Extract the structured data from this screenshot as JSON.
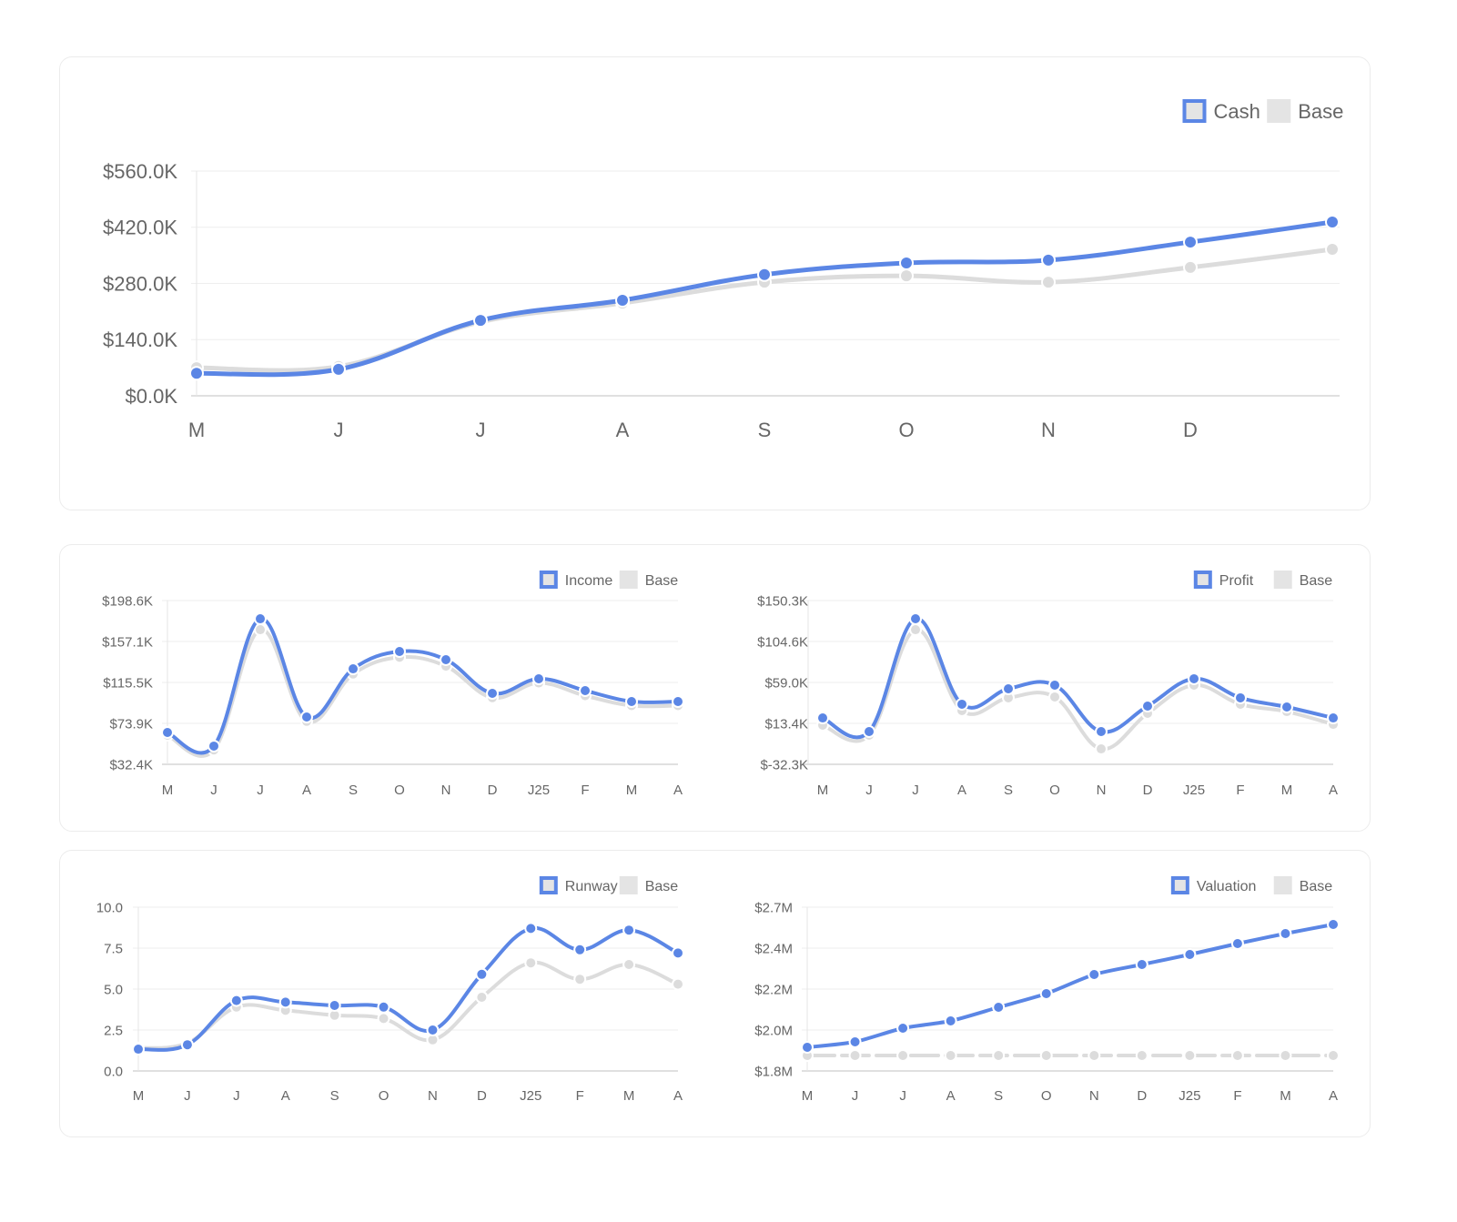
{
  "colors": {
    "primary": "#5b86e5",
    "base": "#dcdcdc",
    "grid": "#eeeeee",
    "axis": "#dddddd",
    "text": "#666666"
  },
  "chart_data": [
    {
      "id": "cash",
      "type": "line",
      "title": "",
      "legend": {
        "placement": "top-right",
        "entries": [
          "Cash",
          "Base"
        ]
      },
      "categories": [
        "M",
        "J",
        "J",
        "A",
        "S",
        "O",
        "N",
        "D",
        ""
      ],
      "yticks": [
        "$0.0K",
        "$140.0K",
        "$280.0K",
        "$420.0K",
        "$560.0K"
      ],
      "ylim": [
        0,
        560000
      ],
      "grid": true,
      "series": [
        {
          "name": "Base",
          "values": [
            70000,
            73000,
            184000,
            231000,
            283000,
            299000,
            283000,
            320000,
            365000
          ]
        },
        {
          "name": "Cash",
          "values": [
            56000,
            66000,
            188000,
            238000,
            302000,
            331000,
            338000,
            383000,
            433000
          ]
        }
      ]
    },
    {
      "id": "income",
      "type": "line",
      "legend": {
        "placement": "top-right",
        "entries": [
          "Income",
          "Base"
        ]
      },
      "categories": [
        "M",
        "J",
        "J",
        "A",
        "S",
        "O",
        "N",
        "D",
        "J25",
        "F",
        "M",
        "A"
      ],
      "yticks": [
        "$32.4K",
        "$73.9K",
        "$115.5K",
        "$157.1K",
        "$198.6K"
      ],
      "ylim": [
        32400,
        198600
      ],
      "grid": true,
      "series": [
        {
          "name": "Base",
          "values": [
            62000,
            47000,
            169000,
            76000,
            124000,
            141000,
            132000,
            100000,
            115000,
            102000,
            92000,
            92000
          ]
        },
        {
          "name": "Income",
          "values": [
            64700,
            50900,
            180100,
            80400,
            129300,
            146900,
            138600,
            104400,
            119200,
            107200,
            96100,
            96100
          ]
        }
      ]
    },
    {
      "id": "profit",
      "type": "line",
      "legend": {
        "placement": "top-right",
        "entries": [
          "Profit",
          "Base"
        ]
      },
      "categories": [
        "M",
        "J",
        "J",
        "A",
        "S",
        "O",
        "N",
        "D",
        "J25",
        "F",
        "M",
        "A"
      ],
      "yticks": [
        "$-32.3K",
        "$13.4K",
        "$59.0K",
        "$104.6K",
        "$150.3K"
      ],
      "ylim": [
        -32300,
        150300
      ],
      "grid": true,
      "series": [
        {
          "name": "Base",
          "values": [
            11300,
            200,
            117800,
            27600,
            41800,
            42800,
            -15100,
            24500,
            56000,
            34700,
            26500,
            12300
          ]
        },
        {
          "name": "Profit",
          "values": [
            19400,
            4200,
            130000,
            34700,
            51900,
            56000,
            4200,
            32600,
            63100,
            41800,
            31600,
            19400
          ]
        }
      ]
    },
    {
      "id": "runway",
      "type": "line",
      "legend": {
        "placement": "top-right",
        "entries": [
          "Runway",
          "Base"
        ]
      },
      "categories": [
        "M",
        "J",
        "J",
        "A",
        "S",
        "O",
        "N",
        "D",
        "J25",
        "F",
        "M",
        "A"
      ],
      "yticks": [
        "0.0",
        "2.5",
        "5.0",
        "7.5",
        "10.0"
      ],
      "ylim": [
        0,
        10
      ],
      "grid": true,
      "series": [
        {
          "name": "Base",
          "values": [
            1.4,
            1.7,
            3.9,
            3.7,
            3.4,
            3.2,
            1.9,
            4.5,
            6.6,
            5.6,
            6.5,
            5.3
          ]
        },
        {
          "name": "Runway",
          "values": [
            1.33,
            1.6,
            4.3,
            4.2,
            4.0,
            3.9,
            2.5,
            5.9,
            8.7,
            7.4,
            8.6,
            7.2
          ]
        }
      ]
    },
    {
      "id": "valuation",
      "type": "line",
      "legend": {
        "placement": "top-right",
        "entries": [
          "Valuation",
          "Base"
        ]
      },
      "categories": [
        "M",
        "J",
        "J",
        "A",
        "S",
        "O",
        "N",
        "D",
        "J25",
        "F",
        "M",
        "A"
      ],
      "yticks": [
        "$1.8M",
        "$2.0M",
        "$2.2M",
        "$2.4M",
        "$2.7M"
      ],
      "ylim": [
        1800000,
        2700000
      ],
      "grid": true,
      "series": [
        {
          "name": "Base",
          "values": [
            1885000,
            1885000,
            1885000,
            1885000,
            1885000,
            1885000,
            1885000,
            1885000,
            1885000,
            1885000,
            1885000,
            1885000
          ]
        },
        {
          "name": "Valuation",
          "values": [
            1930000,
            1960000,
            2035000,
            2075000,
            2150000,
            2225000,
            2330000,
            2385000,
            2440000,
            2500000,
            2555000,
            2605000
          ]
        }
      ]
    }
  ]
}
